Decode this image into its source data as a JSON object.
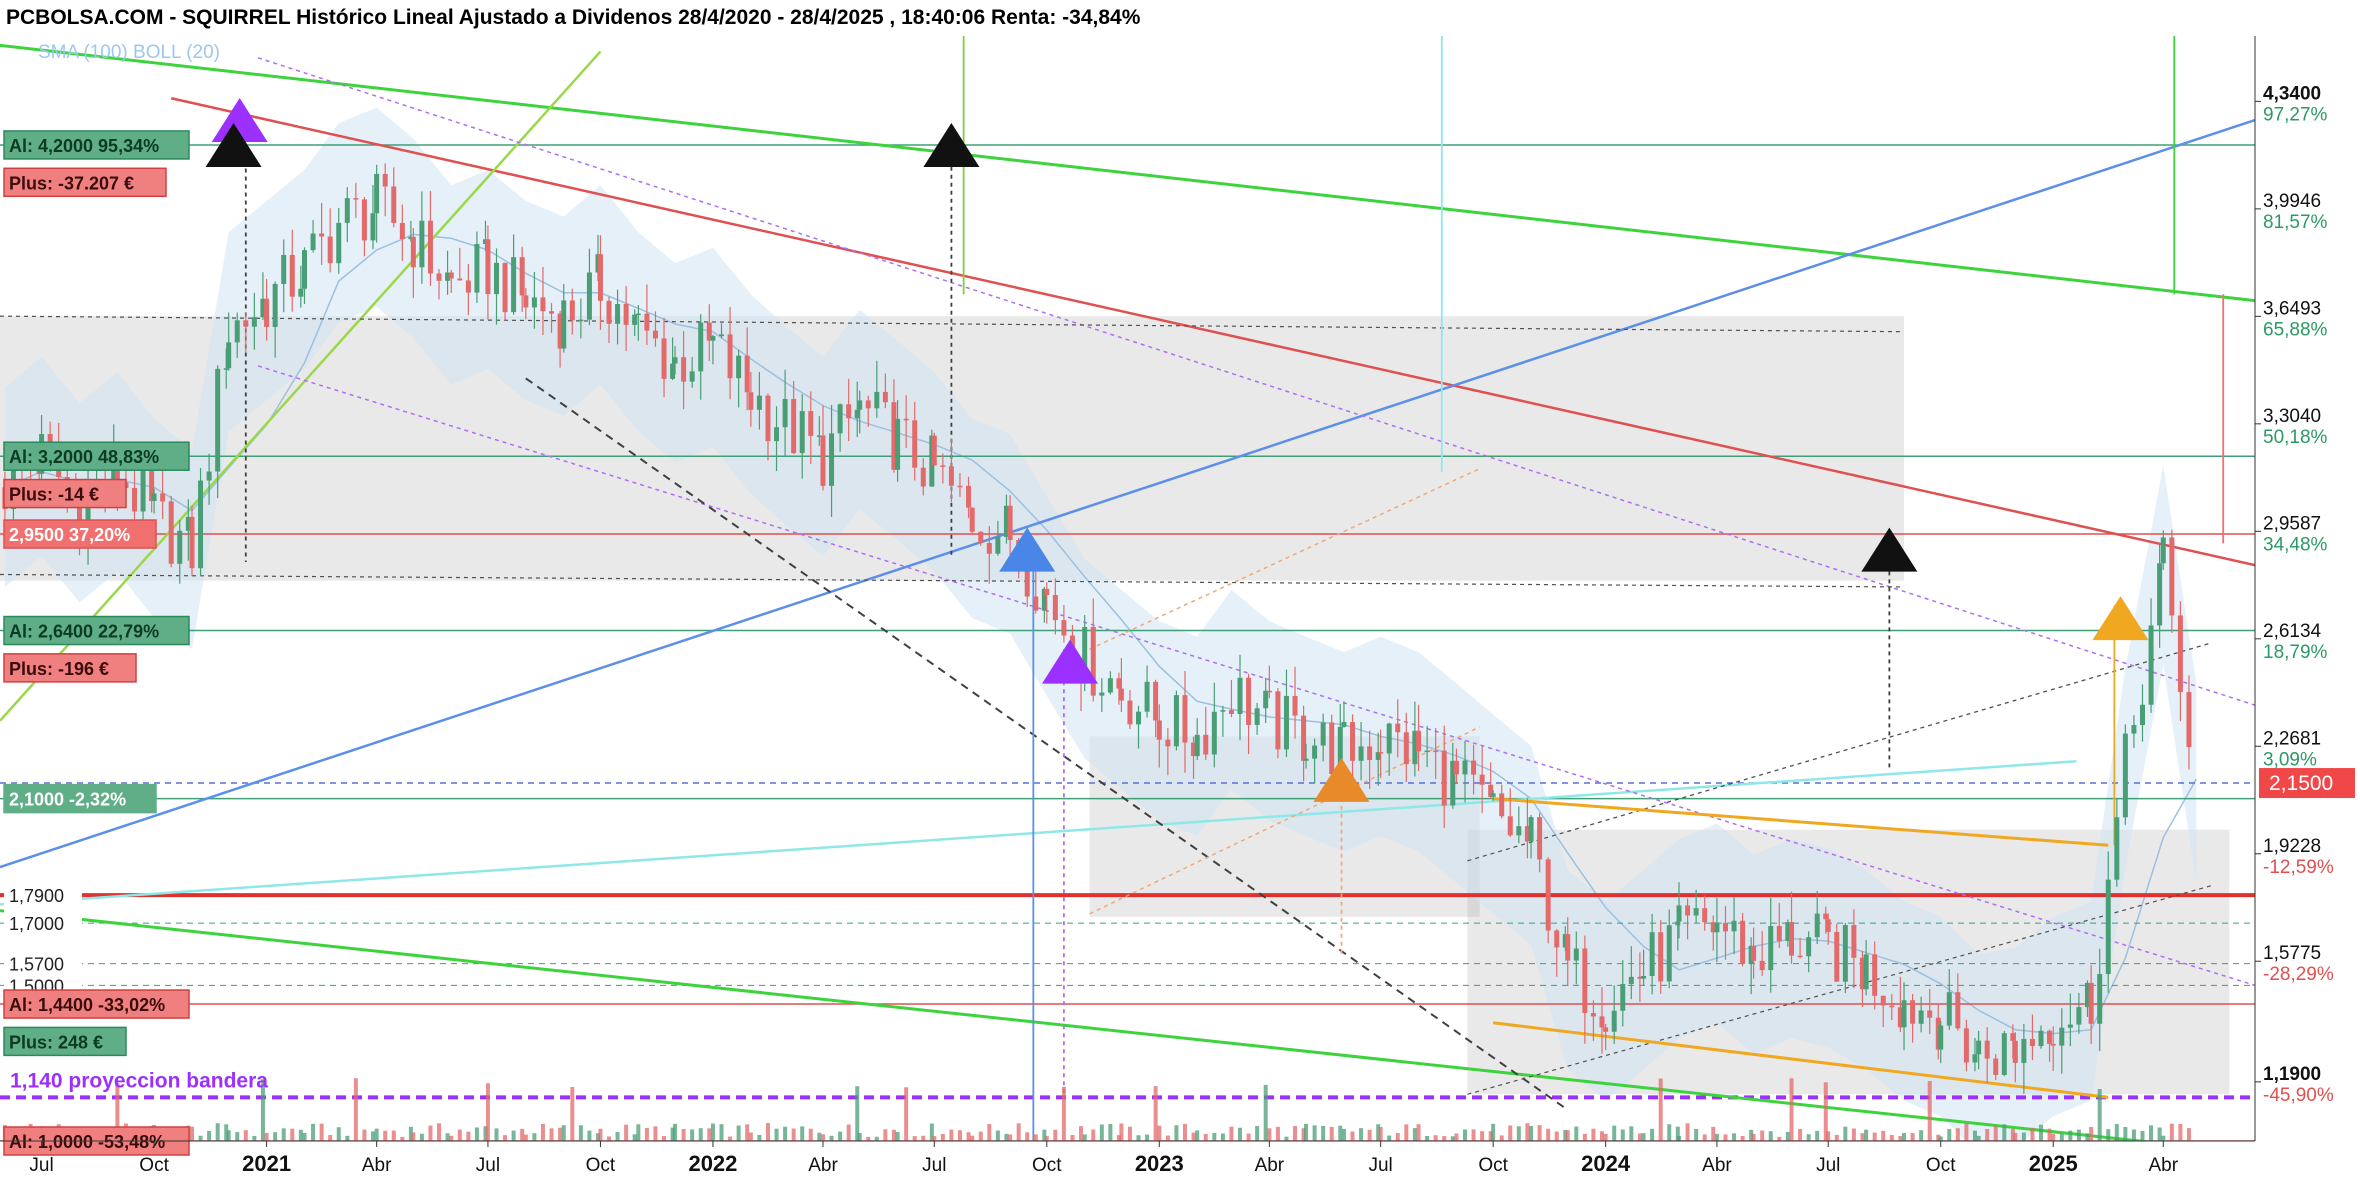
{
  "title": "PCBOLSA.COM - SQUIRREL Histórico Lineal Ajustado a Dividenos 28/4/2020 - 28/4/2025 , 18:40:06 Renta: -34,84%",
  "colors": {
    "up": "#4a9e76",
    "down": "#e26a6a",
    "green_line": "#3dd33d",
    "red_line": "#e05050",
    "blue_line": "#5b8fe8",
    "cyan_line": "#8fe8e8",
    "purple_dotted": "#b06ef0",
    "orange": "#f0a020",
    "label_green": "#5fae88",
    "label_red": "#f07070",
    "pct_up": "#2b9a63",
    "pct_down": "#e05050",
    "boll_fill": "#cfe4f4"
  },
  "chart_data": {
    "type": "candlestick",
    "title": "PCBOLSA.COM - SQUIRREL Histórico Lineal Ajustado a Dividenos 28/4/2020 - 28/4/2025 , 18:40:06 Renta: -34,84%",
    "period": "28/4/2020 - 28/4/2025",
    "indicators": [
      "SMA (100)",
      "BOLL (20)"
    ],
    "x_range": [
      "2020-05-28",
      "2025-06-15"
    ],
    "y_range": [
      1.0,
      4.55
    ],
    "y_scale": "linear",
    "grid": false,
    "current_price": "2,1500",
    "x_ticks": [
      {
        "date": "2020-07-01",
        "label": "Jul",
        "bold": false
      },
      {
        "date": "2020-10-01",
        "label": "Oct",
        "bold": false
      },
      {
        "date": "2021-01-01",
        "label": "2021",
        "bold": true
      },
      {
        "date": "2021-04-01",
        "label": "Abr",
        "bold": false
      },
      {
        "date": "2021-07-01",
        "label": "Jul",
        "bold": false
      },
      {
        "date": "2021-10-01",
        "label": "Oct",
        "bold": false
      },
      {
        "date": "2022-01-01",
        "label": "2022",
        "bold": true
      },
      {
        "date": "2022-04-01",
        "label": "Abr",
        "bold": false
      },
      {
        "date": "2022-07-01",
        "label": "Jul",
        "bold": false
      },
      {
        "date": "2022-10-01",
        "label": "Oct",
        "bold": false
      },
      {
        "date": "2023-01-01",
        "label": "2023",
        "bold": true
      },
      {
        "date": "2023-04-01",
        "label": "Abr",
        "bold": false
      },
      {
        "date": "2023-07-01",
        "label": "Jul",
        "bold": false
      },
      {
        "date": "2023-10-01",
        "label": "Oct",
        "bold": false
      },
      {
        "date": "2024-01-01",
        "label": "2024",
        "bold": true
      },
      {
        "date": "2024-04-01",
        "label": "Abr",
        "bold": false
      },
      {
        "date": "2024-07-01",
        "label": "Jul",
        "bold": false
      },
      {
        "date": "2024-10-01",
        "label": "Oct",
        "bold": false
      },
      {
        "date": "2025-01-01",
        "label": "2025",
        "bold": true
      },
      {
        "date": "2025-04-01",
        "label": "Abr",
        "bold": false
      }
    ],
    "y_ticks": [
      {
        "value": 4.34,
        "price": "4,3400",
        "pct": "97,27%",
        "dir": "up",
        "bold": true
      },
      {
        "value": 3.9946,
        "price": "3,9946",
        "pct": "81,57%",
        "dir": "up",
        "bold": false
      },
      {
        "value": 3.6493,
        "price": "3,6493",
        "pct": "65,88%",
        "dir": "up",
        "bold": false
      },
      {
        "value": 3.304,
        "price": "3,3040",
        "pct": "50,18%",
        "dir": "up",
        "bold": false
      },
      {
        "value": 2.9587,
        "price": "2,9587",
        "pct": "34,48%",
        "dir": "up",
        "bold": false
      },
      {
        "value": 2.6134,
        "price": "2,6134",
        "pct": "18,79%",
        "dir": "up",
        "bold": false
      },
      {
        "value": 2.2681,
        "price": "2,2681",
        "pct": "3,09%",
        "dir": "up",
        "bold": false
      },
      {
        "value": 1.9228,
        "price": "1,9228",
        "pct": "-12,59%",
        "dir": "down",
        "bold": false
      },
      {
        "value": 1.5775,
        "price": "1,5775",
        "pct": "-28,29%",
        "dir": "down",
        "bold": false
      },
      {
        "value": 1.19,
        "price": "1,1900",
        "pct": "-45,90%",
        "dir": "down",
        "bold": true
      }
    ],
    "left_labels": [
      {
        "value": 4.2,
        "text": "Al: 4,2000  95,34%",
        "style": "green"
      },
      {
        "value": 4.08,
        "text": "Plus: -37.207 €",
        "style": "red"
      },
      {
        "value": 3.2,
        "text": "Al: 3,2000  48,83%",
        "style": "green"
      },
      {
        "value": 3.08,
        "text": "Plus: -14 €",
        "style": "red"
      },
      {
        "value": 2.95,
        "text": "2,9500  37,20%",
        "style": "red-solid"
      },
      {
        "value": 2.64,
        "text": "Al: 2,6400  22,79%",
        "style": "green"
      },
      {
        "value": 2.52,
        "text": "Plus: -196 €",
        "style": "red"
      },
      {
        "value": 2.1,
        "text": "2,1000  -2,32%",
        "style": "green-solid"
      },
      {
        "value": 1.79,
        "text": "1,7900",
        "style": "plain"
      },
      {
        "value": 1.7,
        "text": "1,7000",
        "style": "plain"
      },
      {
        "value": 1.57,
        "text": "1,5700",
        "style": "plain"
      },
      {
        "value": 1.5,
        "text": "1,5000",
        "style": "plain"
      },
      {
        "value": 1.44,
        "text": "Al: 1,4400  -33,02%",
        "style": "red"
      },
      {
        "value": 1.32,
        "text": "Plus: 248 €",
        "style": "green"
      },
      {
        "value": 1.0,
        "text": "Al: 1,0000  -53,48%",
        "style": "red"
      }
    ],
    "annotation": {
      "value": 1.14,
      "text": "1,140   proyeccion bandera"
    },
    "horizontal_levels": [
      {
        "value": 4.2,
        "color": "#3f9f77",
        "dash": "solid",
        "width": 1.5
      },
      {
        "value": 3.2,
        "color": "#3f9f77",
        "dash": "solid",
        "width": 1.5
      },
      {
        "value": 2.95,
        "color": "#e05050",
        "dash": "solid",
        "width": 1.5
      },
      {
        "value": 2.64,
        "color": "#3f9f77",
        "dash": "solid",
        "width": 1.5
      },
      {
        "value": 2.15,
        "color": "#5b6fd8",
        "dash": "dashed",
        "width": 1.5
      },
      {
        "value": 2.1,
        "color": "#3f9f77",
        "dash": "solid",
        "width": 1.5
      },
      {
        "value": 1.79,
        "color": "#e03030",
        "dash": "solid",
        "width": 4
      },
      {
        "value": 1.7,
        "color": "#3f9f77",
        "dash": "dashed",
        "width": 1
      },
      {
        "value": 1.57,
        "color": "#3f9f77",
        "dash": "dashed",
        "width": 1
      },
      {
        "value": 1.5,
        "color": "#3f9f77",
        "dash": "dashed",
        "width": 1
      },
      {
        "value": 1.44,
        "color": "#e05050",
        "dash": "solid",
        "width": 1.5
      },
      {
        "value": 1.14,
        "color": "#9b30ff",
        "dash": "dashed",
        "width": 4
      },
      {
        "value": 1.0,
        "color": "#e05050",
        "dash": "solid",
        "width": 1.5
      }
    ],
    "trend_lines": [
      {
        "from": [
          "2020-05-28",
          4.52
        ],
        "to": [
          "2025-06-15",
          3.7
        ],
        "color": "#3dd33d",
        "width": 3,
        "dash": ""
      },
      {
        "from": [
          "2020-05-28",
          1.74
        ],
        "to": [
          "2025-06-15",
          0.96
        ],
        "color": "#3dd33d",
        "width": 3,
        "dash": ""
      },
      {
        "from": [
          "2020-10-15",
          4.35
        ],
        "to": [
          "2025-06-15",
          2.85
        ],
        "color": "#e05050",
        "width": 2.5,
        "dash": ""
      },
      {
        "from": [
          "2020-05-28",
          1.88
        ],
        "to": [
          "2025-06-15",
          4.28
        ],
        "color": "#5b8fe8",
        "width": 2.5,
        "dash": ""
      },
      {
        "from": [
          "2020-05-28",
          2.35
        ],
        "to": [
          "2021-10-01",
          4.5
        ],
        "color": "#9ad84a",
        "width": 2.5,
        "dash": ""
      },
      {
        "from": [
          "2020-05-28",
          1.76
        ],
        "to": [
          "2025-01-20",
          2.22
        ],
        "color": "#8fe8e8",
        "width": 2.5,
        "dash": ""
      },
      {
        "from": [
          "2020-12-25",
          4.48
        ],
        "to": [
          "2025-06-15",
          2.4
        ],
        "color": "#b06ef0",
        "width": 1.5,
        "dash": "4,4"
      },
      {
        "from": [
          "2020-12-25",
          3.49
        ],
        "to": [
          "2025-06-15",
          1.5
        ],
        "color": "#b06ef0",
        "width": 1.5,
        "dash": "4,4"
      },
      {
        "from": [
          "2021-08-01",
          3.45
        ],
        "to": [
          "2023-12-01",
          1.1
        ],
        "color": "#404040",
        "width": 2,
        "dash": "8,6"
      },
      {
        "from": [
          "2023-09-10",
          1.9
        ],
        "to": [
          "2025-05-10",
          2.6
        ],
        "color": "#505050",
        "width": 1.2,
        "dash": "4,4"
      },
      {
        "from": [
          "2023-09-10",
          1.15
        ],
        "to": [
          "2025-05-10",
          1.82
        ],
        "color": "#505050",
        "width": 1.2,
        "dash": "4,4"
      },
      {
        "from": [
          "2022-11-05",
          2.58
        ],
        "to": [
          "2023-09-20",
          3.16
        ],
        "color": "#f0a878",
        "width": 1.5,
        "dash": "4,4"
      },
      {
        "from": [
          "2022-11-05",
          1.73
        ],
        "to": [
          "2023-09-20",
          2.33
        ],
        "color": "#f0a878",
        "width": 1.5,
        "dash": "4,4"
      },
      {
        "from": [
          "2023-10-01",
          2.1
        ],
        "to": [
          "2025-02-15",
          1.95
        ],
        "color": "#f0a820",
        "width": 3,
        "dash": ""
      },
      {
        "from": [
          "2023-10-01",
          1.38
        ],
        "to": [
          "2025-02-15",
          1.14
        ],
        "color": "#f0a820",
        "width": 3,
        "dash": ""
      },
      {
        "from": [
          "2020-05-28",
          3.65
        ],
        "to": [
          "2024-09-01",
          3.6
        ],
        "color": "#505050",
        "width": 1.2,
        "dash": "4,4"
      },
      {
        "from": [
          "2020-05-28",
          2.82
        ],
        "to": [
          "2024-09-01",
          2.78
        ],
        "color": "#505050",
        "width": 1.2,
        "dash": "4,4"
      }
    ],
    "vertical_lines": [
      {
        "date": "2022-09-20",
        "top": 2.92,
        "bottom": 1.0,
        "color": "#5b8fe8",
        "dash": ""
      },
      {
        "date": "2022-10-15",
        "top": 2.58,
        "bottom": 1.15,
        "color": "#b06ef0",
        "dash": "4,4"
      },
      {
        "date": "2023-05-30",
        "top": 2.18,
        "bottom": 1.6,
        "color": "#f0a878",
        "dash": "4,4"
      },
      {
        "date": "2022-07-15",
        "top": 4.13,
        "bottom": 2.88,
        "color": "#404040",
        "dash": "4,4"
      },
      {
        "date": "2024-08-20",
        "top": 2.83,
        "bottom": 2.2,
        "color": "#404040",
        "dash": "4,4"
      },
      {
        "date": "2020-12-15",
        "top": 4.15,
        "bottom": 2.86,
        "color": "#404040",
        "dash": "4,4"
      },
      {
        "date": "2022-07-25",
        "top": 4.55,
        "bottom": 3.72,
        "color": "#7fd040",
        "dash": ""
      },
      {
        "date": "2023-08-20",
        "top": 4.55,
        "bottom": 3.15,
        "color": "#8fe8e8",
        "dash": ""
      },
      {
        "date": "2025-04-10",
        "top": 4.55,
        "bottom": 3.72,
        "color": "#3dd33d",
        "dash": ""
      },
      {
        "date": "2025-05-20",
        "top": 3.72,
        "bottom": 2.92,
        "color": "#f07070",
        "dash": ""
      },
      {
        "date": "2025-02-20",
        "top": 2.72,
        "bottom": 1.95,
        "color": "#f0a820",
        "dash": ""
      }
    ],
    "shaded_zones": [
      {
        "from": [
          "2020-05-28",
          3.65
        ],
        "to": [
          "2024-09-01",
          2.8
        ]
      },
      {
        "from": [
          "2022-11-05",
          2.3
        ],
        "to": [
          "2023-09-20",
          1.72
        ]
      },
      {
        "from": [
          "2023-09-10",
          2.0
        ],
        "to": [
          "2025-05-25",
          1.15
        ]
      }
    ],
    "markers": [
      {
        "date": "2020-12-10",
        "value": 4.28,
        "color": "#9b30ff"
      },
      {
        "date": "2020-12-05",
        "value": 4.2,
        "color": "#111111"
      },
      {
        "date": "2022-07-15",
        "value": 4.2,
        "color": "#111111"
      },
      {
        "date": "2022-09-15",
        "value": 2.9,
        "color": "#4a86e8"
      },
      {
        "date": "2022-10-20",
        "value": 2.54,
        "color": "#9b30ff"
      },
      {
        "date": "2023-05-30",
        "value": 2.16,
        "color": "#e88a2a"
      },
      {
        "date": "2024-08-20",
        "value": 2.9,
        "color": "#111111"
      },
      {
        "date": "2025-02-25",
        "value": 2.68,
        "color": "#f0a820"
      }
    ],
    "series": [
      {
        "name": "precio",
        "x": [
          "2020-06-01",
          "2020-07-01",
          "2020-08-01",
          "2020-09-01",
          "2020-10-01",
          "2020-11-01",
          "2020-12-01",
          "2021-01-01",
          "2021-02-01",
          "2021-03-01",
          "2021-04-01",
          "2021-05-01",
          "2021-06-01",
          "2021-07-01",
          "2021-08-01",
          "2021-09-01",
          "2021-10-01",
          "2021-11-01",
          "2021-12-01",
          "2022-01-01",
          "2022-02-01",
          "2022-03-01",
          "2022-04-01",
          "2022-05-01",
          "2022-06-01",
          "2022-07-01",
          "2022-08-01",
          "2022-09-01",
          "2022-10-01",
          "2022-11-01",
          "2022-12-01",
          "2023-01-01",
          "2023-02-01",
          "2023-03-01",
          "2023-04-01",
          "2023-05-01",
          "2023-06-01",
          "2023-07-01",
          "2023-08-01",
          "2023-09-01",
          "2023-10-01",
          "2023-11-01",
          "2023-12-01",
          "2024-01-01",
          "2024-02-01",
          "2024-03-01",
          "2024-04-01",
          "2024-05-01",
          "2024-06-01",
          "2024-07-01",
          "2024-08-01",
          "2024-09-01",
          "2024-10-01",
          "2024-11-01",
          "2024-12-01",
          "2025-01-01",
          "2025-02-01",
          "2025-03-01",
          "2025-04-01",
          "2025-04-28"
        ],
        "values": [
          3.1,
          3.2,
          3.05,
          3.15,
          3.0,
          2.9,
          3.6,
          3.7,
          3.8,
          3.95,
          4.0,
          3.9,
          3.75,
          3.8,
          3.7,
          3.65,
          3.75,
          3.6,
          3.5,
          3.55,
          3.4,
          3.3,
          3.2,
          3.35,
          3.25,
          3.15,
          3.0,
          2.95,
          2.75,
          2.55,
          2.45,
          2.35,
          2.3,
          2.45,
          2.35,
          2.3,
          2.25,
          2.3,
          2.25,
          2.15,
          2.05,
          1.95,
          1.55,
          1.45,
          1.55,
          1.65,
          1.7,
          1.6,
          1.65,
          1.62,
          1.55,
          1.45,
          1.4,
          1.28,
          1.3,
          1.4,
          1.45,
          2.2,
          2.85,
          2.15
        ]
      }
    ]
  }
}
